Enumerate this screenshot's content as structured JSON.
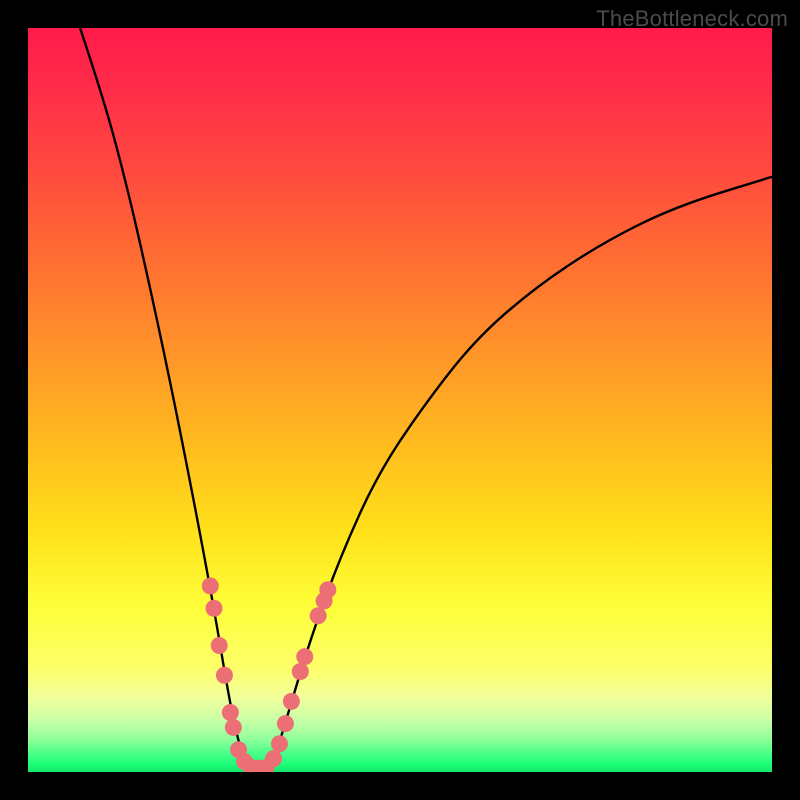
{
  "watermark": "TheBottleneck.com",
  "colors": {
    "frame": "#000000",
    "curve_stroke": "#000000",
    "marker_fill": "#ed6f76",
    "marker_stroke": "#b54c53"
  },
  "chart_data": {
    "type": "line",
    "title": "",
    "xlabel": "",
    "ylabel": "",
    "xlim": [
      0,
      100
    ],
    "ylim": [
      0,
      100
    ],
    "curve": {
      "description": "V-shaped bottleneck curve; y≈100 at edges, minimum y≈0 near x≈28-33",
      "points": [
        {
          "x": 7,
          "y": 100
        },
        {
          "x": 10,
          "y": 91
        },
        {
          "x": 13,
          "y": 80
        },
        {
          "x": 16,
          "y": 67
        },
        {
          "x": 19,
          "y": 53
        },
        {
          "x": 22,
          "y": 38
        },
        {
          "x": 25,
          "y": 22
        },
        {
          "x": 27,
          "y": 10
        },
        {
          "x": 28.5,
          "y": 3
        },
        {
          "x": 30,
          "y": 0.5
        },
        {
          "x": 32,
          "y": 0.5
        },
        {
          "x": 33.5,
          "y": 3
        },
        {
          "x": 35,
          "y": 8
        },
        {
          "x": 38,
          "y": 18
        },
        {
          "x": 42,
          "y": 29
        },
        {
          "x": 47,
          "y": 40
        },
        {
          "x": 53,
          "y": 49
        },
        {
          "x": 60,
          "y": 58
        },
        {
          "x": 68,
          "y": 65
        },
        {
          "x": 77,
          "y": 71
        },
        {
          "x": 87,
          "y": 76
        },
        {
          "x": 100,
          "y": 80
        }
      ]
    },
    "series": [
      {
        "name": "markers",
        "type": "scatter",
        "points": [
          {
            "x": 24.5,
            "y": 25
          },
          {
            "x": 25.0,
            "y": 22
          },
          {
            "x": 25.7,
            "y": 17
          },
          {
            "x": 26.4,
            "y": 13
          },
          {
            "x": 27.2,
            "y": 8
          },
          {
            "x": 27.6,
            "y": 6
          },
          {
            "x": 28.3,
            "y": 3
          },
          {
            "x": 29.1,
            "y": 1.4
          },
          {
            "x": 30.0,
            "y": 0.6
          },
          {
            "x": 31.0,
            "y": 0.5
          },
          {
            "x": 32.0,
            "y": 0.6
          },
          {
            "x": 33.0,
            "y": 1.8
          },
          {
            "x": 33.8,
            "y": 3.8
          },
          {
            "x": 34.6,
            "y": 6.5
          },
          {
            "x": 35.4,
            "y": 9.5
          },
          {
            "x": 36.6,
            "y": 13.5
          },
          {
            "x": 37.2,
            "y": 15.5
          },
          {
            "x": 39.0,
            "y": 21
          },
          {
            "x": 39.8,
            "y": 23
          },
          {
            "x": 40.3,
            "y": 24.5
          }
        ]
      }
    ]
  }
}
